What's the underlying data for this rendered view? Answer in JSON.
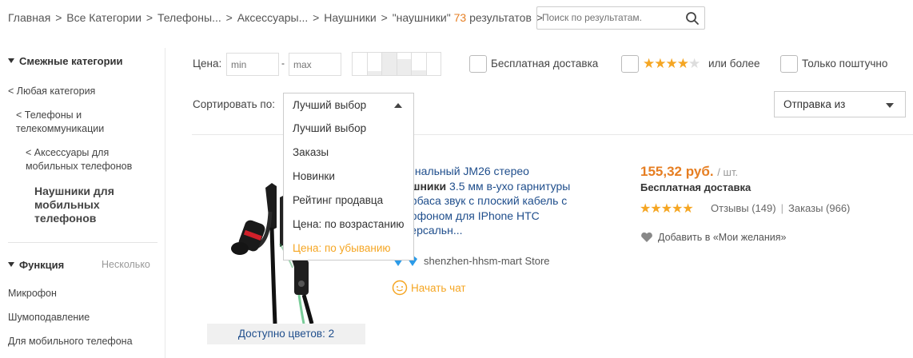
{
  "breadcrumb": {
    "items": [
      "Главная",
      "Все Категории",
      "Телефоны...",
      "Аксессуары...",
      "Наушники"
    ],
    "query": "\"наушники\"",
    "count": "73",
    "results_label": "результатов",
    "separator": ">"
  },
  "search": {
    "placeholder": "Поиск по результатам."
  },
  "sidebar": {
    "related_heading": "Смежные категории",
    "links": [
      "< Любая категория",
      "< Телефоны и телекоммуникации",
      "< Аксессуары для мобильных телефонов"
    ],
    "active": "Наушники для мобильных телефонов",
    "function_heading": "Функция",
    "function_mode": "Несколько",
    "functions": [
      "Микрофон",
      "Шумоподавление",
      "Для мобильного телефона"
    ]
  },
  "filters": {
    "price_label": "Цена:",
    "min_placeholder": "min",
    "dash": "-",
    "max_placeholder": "max",
    "free_shipping": "Бесплатная доставка",
    "rating_stars": 4,
    "rating_suffix": "или более",
    "single_item": "Только поштучно",
    "sort_label": "Сортировать по:",
    "sort_value": "Лучший выбор",
    "ship_from": "Отправка из"
  },
  "sort_options": [
    "Лучший выбор",
    "Заказы",
    "Новинки",
    "Рейтинг продавца",
    "Цена: по возрастанию",
    "Цена: по убыванию"
  ],
  "sort_highlighted": "Цена: по убыванию",
  "product": {
    "title_prefix": "гинальный JM26 стерео",
    "title_bold": "ушники",
    "title_rest": "3.5 мм в-ухо гарнитуры ербаса звук с плоский кабель с рофоном для IPhone HTC версальн...",
    "colors": "Доступно цветов: 2",
    "store": "shenzhen-hhsm-mart Store",
    "chat": "Начать чат",
    "price": "155,32 руб.",
    "unit": "/ шт.",
    "shipping": "Бесплатная доставка",
    "stars": 5,
    "reviews": "Отзывы (149)",
    "orders": "Заказы (966)",
    "wishlist": "Добавить в «Мои желания»"
  },
  "colors": {
    "accent": "#f5a623",
    "price": "#e67e22",
    "link": "#1f4e8c"
  }
}
